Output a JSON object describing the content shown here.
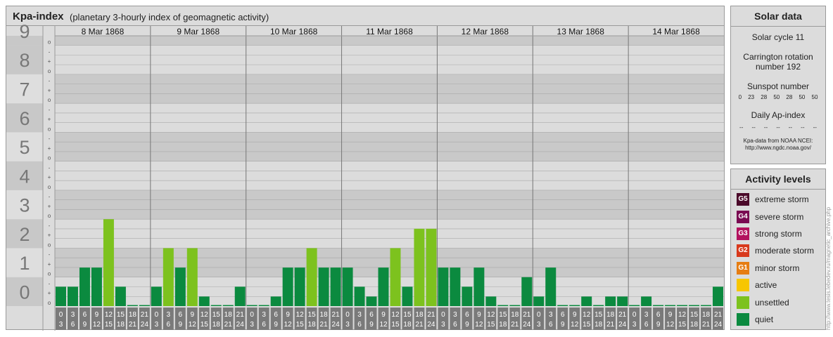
{
  "header": {
    "title": "Kpa-index",
    "subtitle": "(planetary 3-hourly index of geomagnetic activity)"
  },
  "solar": {
    "title": "Solar data",
    "cycle": "Solar cycle 11",
    "rotation_line1": "Carrington rotation",
    "rotation_line2": "number 192",
    "sunspot_label": "Sunspot number",
    "sunspot_values": [
      "0",
      "23",
      "28",
      "50",
      "28",
      "50",
      "50"
    ],
    "ap_label": "Daily Ap-index",
    "ap_values": [
      "--",
      "--",
      "--",
      "--",
      "--",
      "--",
      "--"
    ],
    "source_line1": "Kpa-data from NOAA NCEI:",
    "source_line2": "http://www.ngdc.noaa.gov/"
  },
  "levels": {
    "title": "Activity levels",
    "items": [
      {
        "badge": "G5",
        "label": "extreme storm",
        "color": "#4b0a2a"
      },
      {
        "badge": "G4",
        "label": "severe storm",
        "color": "#7a0a52"
      },
      {
        "badge": "G3",
        "label": "strong storm",
        "color": "#b3125e"
      },
      {
        "badge": "G2",
        "label": "moderate storm",
        "color": "#d8391c"
      },
      {
        "badge": "G1",
        "label": "minor storm",
        "color": "#e67d12"
      },
      {
        "badge": "",
        "label": "active",
        "color": "#f7c600"
      },
      {
        "badge": "",
        "label": "unsettled",
        "color": "#7dc21e"
      },
      {
        "badge": "",
        "label": "quiet",
        "color": "#0b8a3f"
      }
    ]
  },
  "credit": "http://www.tesis.lebedev.ru/magnetic_archive.php",
  "colors": {
    "quiet": "#0b8a3f",
    "unsettled": "#7dc21e",
    "active": "#f7c600"
  },
  "chart_data": {
    "type": "bar",
    "days": [
      "8 Mar 1868",
      "9 Mar 1868",
      "10 Mar 1868",
      "11 Mar 1868",
      "12 Mar 1868",
      "13 Mar 1868",
      "14 Mar 1868"
    ],
    "y_ticks": [
      "0",
      "1",
      "2",
      "3",
      "4",
      "5",
      "6",
      "7",
      "8",
      "9"
    ],
    "sub_ticks": [
      "o",
      "+",
      "-"
    ],
    "hour_top": [
      "0",
      "3",
      "6",
      "9",
      "12",
      "15",
      "18",
      "21"
    ],
    "hour_bottom": [
      "3",
      "6",
      "9",
      "12",
      "15",
      "18",
      "21",
      "24"
    ],
    "ylim": [
      0,
      9.33
    ],
    "series": [
      {
        "values": [
          0.67,
          0.67,
          1.33,
          1.33,
          3.0,
          0.67,
          0.0,
          0.0
        ]
      },
      {
        "values": [
          0.67,
          2.0,
          1.33,
          2.0,
          0.33,
          0.0,
          0.0,
          0.67
        ]
      },
      {
        "values": [
          0.0,
          0.0,
          0.33,
          1.33,
          1.33,
          2.0,
          1.33,
          1.33
        ]
      },
      {
        "values": [
          1.33,
          0.67,
          0.33,
          1.33,
          2.0,
          0.67,
          2.67,
          2.67
        ]
      },
      {
        "values": [
          1.33,
          1.33,
          0.67,
          1.33,
          0.33,
          0.0,
          0.0,
          1.0
        ]
      },
      {
        "values": [
          0.33,
          1.33,
          0.0,
          0.0,
          0.33,
          0.0,
          0.33,
          0.33
        ]
      },
      {
        "values": [
          0.0,
          0.33,
          0.0,
          0.0,
          0.0,
          0.0,
          0.0,
          0.67
        ]
      }
    ]
  }
}
